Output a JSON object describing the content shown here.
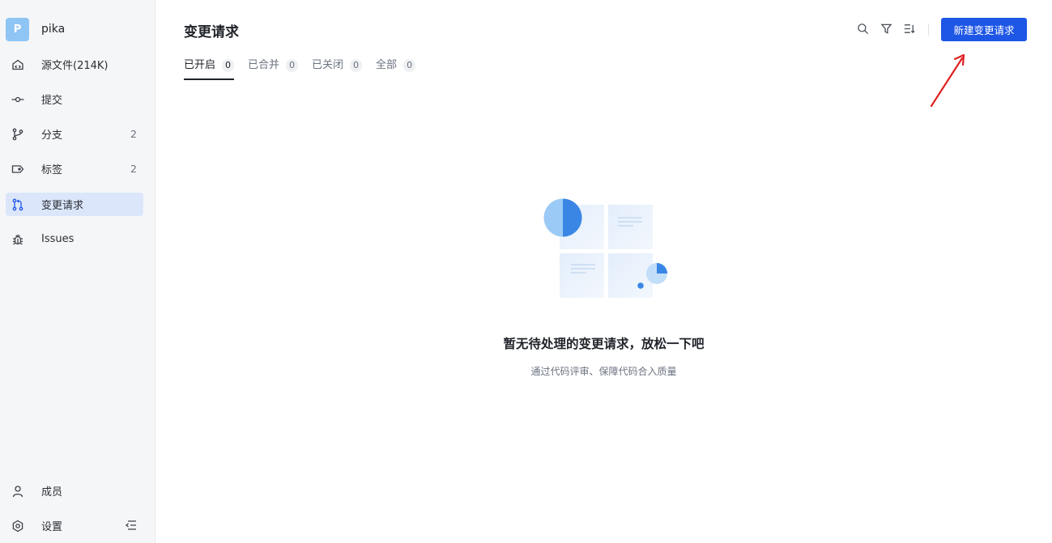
{
  "repo": {
    "avatar_letter": "P",
    "name": "pika"
  },
  "sidebar": {
    "items": [
      {
        "label": "源文件(214K)",
        "count": "",
        "icon": "code-folder-icon"
      },
      {
        "label": "提交",
        "count": "",
        "icon": "commit-icon"
      },
      {
        "label": "分支",
        "count": "2",
        "icon": "branch-icon"
      },
      {
        "label": "标签",
        "count": "2",
        "icon": "tag-icon"
      },
      {
        "label": "变更请求",
        "count": "",
        "icon": "pull-request-icon",
        "active": true
      },
      {
        "label": "Issues",
        "count": "",
        "icon": "bug-icon"
      }
    ],
    "bottom": [
      {
        "label": "成员",
        "icon": "person-icon"
      },
      {
        "label": "设置",
        "icon": "settings-icon"
      }
    ],
    "collapse_icon": "collapse-sidebar-icon"
  },
  "main": {
    "title": "变更请求",
    "tabs": [
      {
        "label": "已开启",
        "count": "0",
        "active": true
      },
      {
        "label": "已合并",
        "count": "0"
      },
      {
        "label": "已关闭",
        "count": "0"
      },
      {
        "label": "全部",
        "count": "0"
      }
    ],
    "toolbar": {
      "search_icon": "search-icon",
      "filter_icon": "filter-icon",
      "sort_icon": "sort-icon",
      "new_button_label": "新建变更请求"
    },
    "empty": {
      "title": "暂无待处理的变更请求，放松一下吧",
      "subtitle": "通过代码评审、保障代码合入质量"
    }
  },
  "colors": {
    "primary": "#1e56e6",
    "active_nav_bg": "#dbe6fb",
    "sidebar_bg": "#f5f6f7",
    "annotation_arrow": "#e02020"
  }
}
